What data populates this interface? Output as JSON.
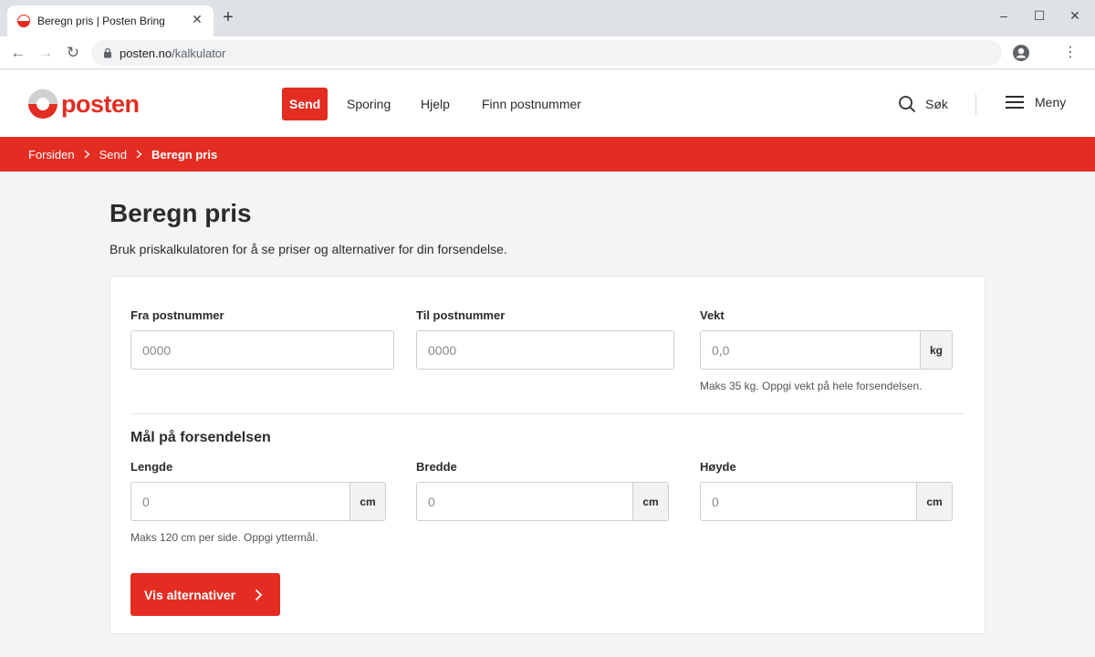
{
  "browser": {
    "tab_title": "Beregn pris | Posten Bring",
    "url_host": "posten.no",
    "url_path": "/kalkulator"
  },
  "header": {
    "logo_text": "posten",
    "nav": [
      {
        "label": "Send",
        "active": true
      },
      {
        "label": "Sporing",
        "active": false
      },
      {
        "label": "Hjelp",
        "active": false
      },
      {
        "label": "Finn postnummer",
        "active": false
      }
    ],
    "search_label": "Søk",
    "menu_label": "Meny"
  },
  "breadcrumb": {
    "items": [
      "Forsiden",
      "Send"
    ],
    "current": "Beregn pris"
  },
  "page": {
    "title": "Beregn pris",
    "intro": "Bruk priskalkulatoren for å se priser og alternativer for din forsendelse."
  },
  "form": {
    "from_label": "Fra postnummer",
    "from_placeholder": "0000",
    "to_label": "Til postnummer",
    "to_placeholder": "0000",
    "weight_label": "Vekt",
    "weight_placeholder": "0,0",
    "weight_unit": "kg",
    "weight_help": "Maks 35 kg. Oppgi vekt på hele forsendelsen.",
    "dimensions_title": "Mål på forsendelsen",
    "length_label": "Lengde",
    "length_placeholder": "0",
    "width_label": "Bredde",
    "width_placeholder": "0",
    "height_label": "Høyde",
    "height_placeholder": "0",
    "dimension_unit": "cm",
    "dimensions_help": "Maks 120 cm per side. Oppgi yttermål.",
    "submit_label": "Vis alternativer"
  },
  "colors": {
    "brand_red": "#e32d22"
  }
}
